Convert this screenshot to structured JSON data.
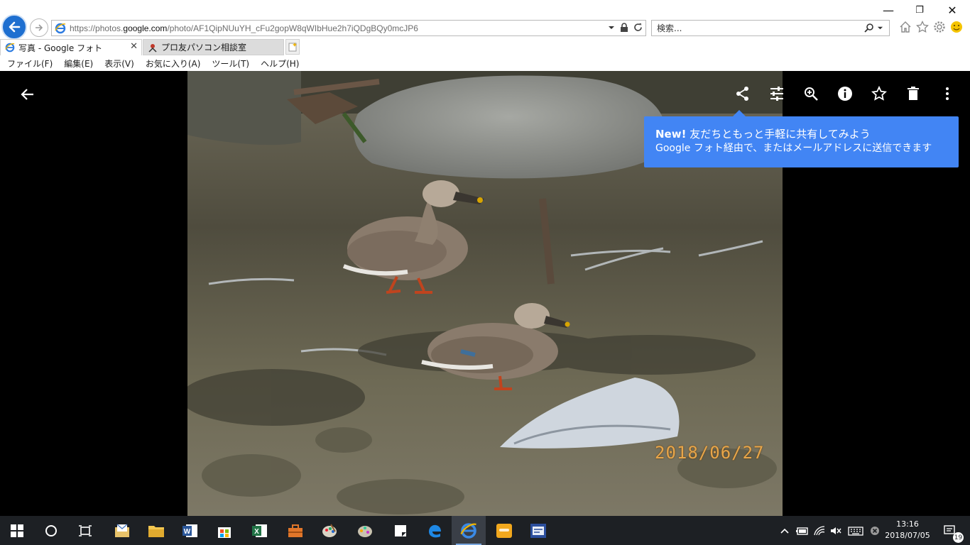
{
  "browser": {
    "url_prefix": "https://photos.",
    "url_domain": "google.com",
    "url_path": "/photo/AF1QipNUuYH_cFu2gopW8qWIbHue2h7iQDgBQy0mcJP6",
    "search_placeholder": "検索...",
    "window_controls": {
      "minimize": "—",
      "restore": "❐",
      "close": "✕"
    },
    "tabs": [
      {
        "label": "写真 - Google フォト",
        "close": "✕"
      },
      {
        "label": "プロ友パソコン相談室"
      }
    ],
    "menu": [
      "ファイル(F)",
      "編集(E)",
      "表示(V)",
      "お気に入り(A)",
      "ツール(T)",
      "ヘルプ(H)"
    ]
  },
  "viewer": {
    "toolbar_icons": [
      "share-icon",
      "edit-adjust-icon",
      "zoom-icon",
      "info-icon",
      "favorite-star-icon",
      "delete-icon",
      "more-icon"
    ],
    "tooltip": {
      "badge": "New!",
      "title": " 友だちともっと手軽に共有してみよう",
      "body": "Google フォト経由で、またはメールアドレスに送信できます"
    },
    "photo_date_stamp": "2018/06/27"
  },
  "taskbar": {
    "time": "13:16",
    "date": "2018/07/05",
    "notification_count": "19",
    "accent": "#7aa7e0"
  }
}
